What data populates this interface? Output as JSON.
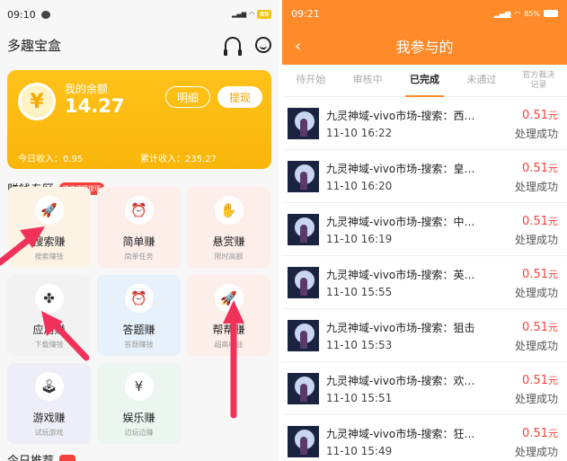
{
  "left": {
    "status": {
      "time": "09:10",
      "battery": "89"
    },
    "app_title": "多趣宝盒",
    "balance": {
      "label": "我的余额",
      "amount": "14.27",
      "detail_btn": "明细",
      "withdraw_btn": "提现",
      "today": "今日收入：0.95",
      "total": "累计收入：235.27",
      "coin_symbol": "¥"
    },
    "section": {
      "title": "赚钱专区",
      "badge": "微信便捷提现"
    },
    "tiles": [
      {
        "title": "搜索赚",
        "sub": "搜索赚钱",
        "icon": "rocket-icon"
      },
      {
        "title": "简单赚",
        "sub": "简单任务",
        "icon": "alarm-icon"
      },
      {
        "title": "悬赏赚",
        "sub": "限时高额",
        "icon": "hand-coin-icon"
      },
      {
        "title": "应用赚",
        "sub": "下载赚钱",
        "icon": "apps-icon"
      },
      {
        "title": "答题赚",
        "sub": "答题赚钱",
        "icon": "alarm-icon"
      },
      {
        "title": "帮帮赚",
        "sub": "超高收益",
        "icon": "rocket-icon"
      },
      {
        "title": "游戏赚",
        "sub": "试玩游戏",
        "icon": "joystick-icon"
      },
      {
        "title": "娱乐赚",
        "sub": "边玩边赚",
        "icon": "coin-icon"
      }
    ],
    "more": {
      "title": "今日推荐"
    },
    "arrow_color": "#f0325a"
  },
  "right": {
    "status": {
      "time": "09:21",
      "battery": "85%"
    },
    "title": "我参与的",
    "tabs": [
      "待开始",
      "审核中",
      "已完成",
      "未通过",
      "官方裁决记录"
    ],
    "active_tab": 2,
    "rows": [
      {
        "name": "九灵神域-vivo市场-搜索：西…",
        "time": "11-10 16:22",
        "amount": "0.51",
        "unit": "元",
        "result": "处理成功"
      },
      {
        "name": "九灵神域-vivo市场-搜索：皇…",
        "time": "11-10 16:20",
        "amount": "0.51",
        "unit": "元",
        "result": "处理成功"
      },
      {
        "name": "九灵神域-vivo市场-搜索：中…",
        "time": "11-10 16:19",
        "amount": "0.51",
        "unit": "元",
        "result": "处理成功"
      },
      {
        "name": "九灵神域-vivo市场-搜索：英…",
        "time": "11-10 15:55",
        "amount": "0.51",
        "unit": "元",
        "result": "处理成功"
      },
      {
        "name": "九灵神域-vivo市场-搜索：狙击",
        "time": "11-10 15:53",
        "amount": "0.51",
        "unit": "元",
        "result": "处理成功"
      },
      {
        "name": "九灵神域-vivo市场-搜索：欢…",
        "time": "11-10 15:51",
        "amount": "0.51",
        "unit": "元",
        "result": "处理成功"
      },
      {
        "name": "九灵神域-vivo市场-搜索：狂…",
        "time": "11-10 15:49",
        "amount": "0.51",
        "unit": "元",
        "result": "处理成功"
      }
    ],
    "accent": "#ff8a2a"
  }
}
